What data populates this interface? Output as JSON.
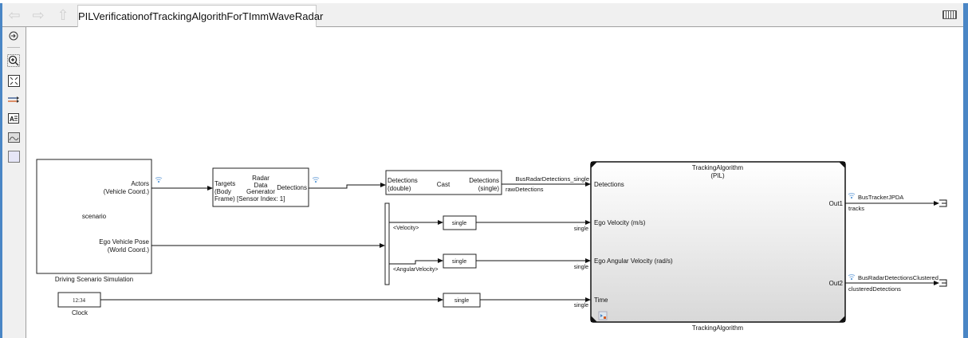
{
  "window": {
    "tab_title": "PILVerificationofTrackingAlgorithForTImmWaveRadar"
  },
  "nav": {
    "back_icon": "arrow-left-icon",
    "forward_icon": "arrow-right-icon",
    "up_icon": "arrow-up-icon",
    "keyboard_icon": "keyboard-icon"
  },
  "toolbar": {
    "items": [
      "hide-show-icon",
      "zoom-icon",
      "fit-view-icon",
      "signal-lines-icon",
      "annotation-icon",
      "image-icon",
      "area-icon"
    ]
  },
  "diagram": {
    "scenario": {
      "caption": "Driving Scenario Simulation",
      "name": "scenario",
      "port1a": "Actors",
      "port1b": "(Vehicle Coord.)",
      "port2a": "Ego Vehicle Pose",
      "port2b": "(World Coord.)"
    },
    "radar": {
      "t1": "Radar",
      "t2": "Data",
      "t3": "Generator",
      "t4": "[Sensor Index: 1]",
      "in1": "Targets",
      "in2": "(Body",
      "in3": "Frame)",
      "out": "Detections"
    },
    "cast": {
      "name": "Cast",
      "in1": "Detections",
      "in2": "(double)",
      "out1": "Detections",
      "out2": "(single)"
    },
    "signals": {
      "bus_single": "BusRadarDetections_single",
      "raw": "rawDetections",
      "velocity": "<Velocity>",
      "angular": "<AngularVelocity>",
      "single": "single",
      "tracker_bus": "BusTrackerJPDA",
      "tracks": "tracks",
      "clustered_bus": "BusRadarDetectionsClustered",
      "clustered": "clusteredDetections"
    },
    "convert": {
      "label": "single"
    },
    "clock": {
      "display": "12:34",
      "caption": "Clock"
    },
    "tracking": {
      "title1": "TrackingAlgorithm",
      "title2": "(PIL)",
      "in1": "Detections",
      "in2": "Ego Velocity (m/s)",
      "in3": "Ego Angular Velocity (rad/s)",
      "in4": "Time",
      "out1": "Out1",
      "out2": "Out2",
      "caption": "TrackingAlgorithm"
    }
  }
}
